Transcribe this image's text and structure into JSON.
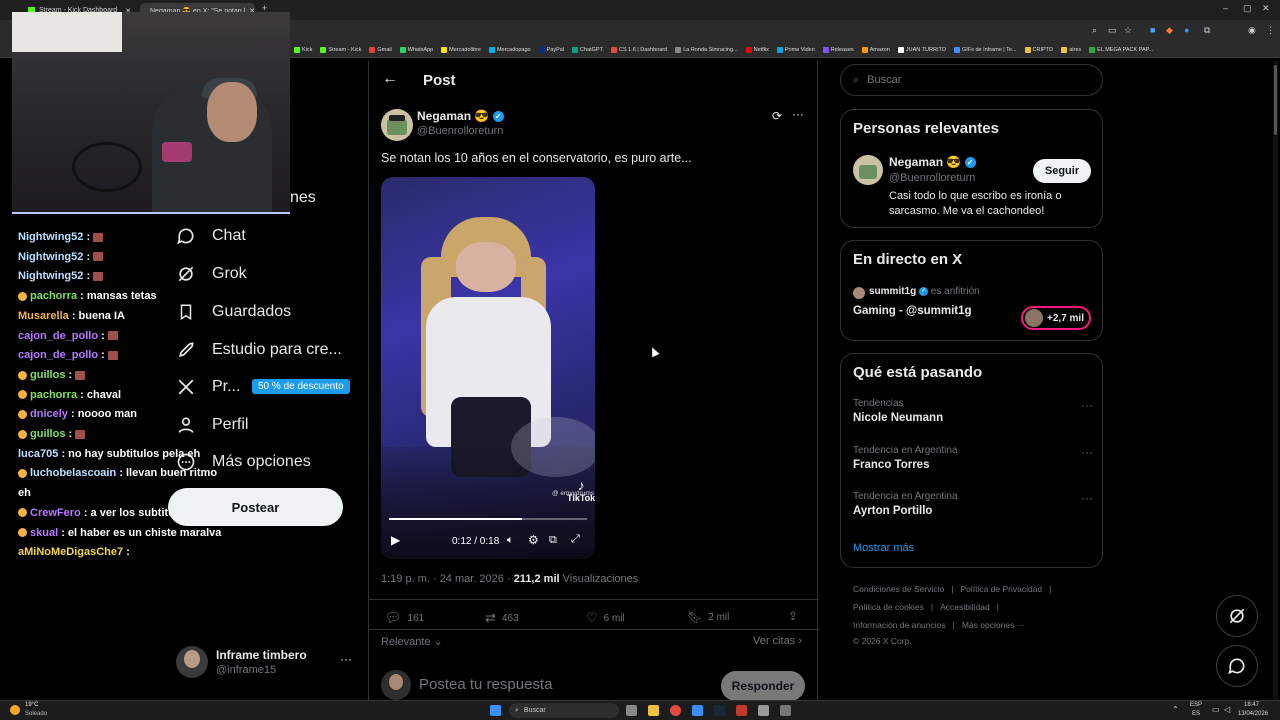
{
  "browser": {
    "tabs": [
      {
        "label": "Stream - Kick Dashboard"
      },
      {
        "label": "Negaman 😎 en X: \"Se notan l"
      }
    ],
    "new_tab": "+",
    "bookmarks": [
      "Kick",
      "Stream - Kick",
      "Gmail",
      "WhatsApp",
      "Mercadolibre",
      "Mercadopago",
      "PayPal",
      "ChatGPT",
      "CS 1.6 | Dashboard",
      "La Ronda Simracing...",
      "Netflix",
      "Prime Video",
      "Releases",
      "Amazon",
      "JUAN TURRITO",
      "GIFs de Inframe | Te...",
      "CRIPTO",
      "aires",
      "EL MEGA PACK PAP..."
    ]
  },
  "chat": {
    "messages": [
      {
        "user": "Nightwing52",
        "color": "#b9e0ff",
        "text": ":",
        "emote": true
      },
      {
        "user": "Nightwing52",
        "color": "#b9e0ff",
        "text": ":",
        "emote": true
      },
      {
        "user": "Nightwing52",
        "color": "#b9e0ff",
        "text": ":",
        "emote": true
      },
      {
        "user": "pachorra",
        "color": "#7ee15a",
        "text": ": mansas tetas",
        "emote": false,
        "badge": true
      },
      {
        "user": "Musarella",
        "color": "#f5b342",
        "text": ": buena IA",
        "emote": false
      },
      {
        "user": "cajon_de_pollo",
        "color": "#b678ff",
        "text": ":",
        "emote": true
      },
      {
        "user": "cajon_de_pollo",
        "color": "#b678ff",
        "text": ":",
        "emote": true
      },
      {
        "user": "guillos",
        "color": "#7ee15a",
        "text": ":",
        "emote": true,
        "badge": true
      },
      {
        "user": "pachorra",
        "color": "#7ee15a",
        "text": ": chaval",
        "emote": false,
        "badge": true
      },
      {
        "user": "dnicely",
        "color": "#b678ff",
        "text": ": noooo man",
        "emote": false,
        "badge": true
      },
      {
        "user": "guillos",
        "color": "#7ee15a",
        "text": ":",
        "emote": true,
        "badge": true
      },
      {
        "user": "luca705",
        "color": "#b9e0ff",
        "text": ": no hay subtitulos pela eh",
        "emote": false
      },
      {
        "user": "luchobelascoain",
        "color": "#b9e0ff",
        "text": ": llevan buen ritmo",
        "emote": false,
        "badge": true
      },
      {
        "user": "",
        "color": "#fff",
        "text": "eh",
        "emote": false
      },
      {
        "user": "CrewFero",
        "color": "#b678ff",
        "text": ": a ver los subtitulos",
        "emote": false,
        "badge": true
      },
      {
        "user": "skual",
        "color": "#b678ff",
        "text": ": el haber es un chiste maralva",
        "emote": false,
        "badge": true
      },
      {
        "user": "aMiNoMeDigasChe7",
        "color": "#f5d742",
        "text": ":",
        "emote": false
      }
    ]
  },
  "nav": {
    "partial_label": "nes",
    "items": [
      {
        "label": "Chat"
      },
      {
        "label": "Grok"
      },
      {
        "label": "Guardados"
      },
      {
        "label": "Estudio para cre..."
      },
      {
        "label": "Pr..."
      },
      {
        "label": "Perfil"
      },
      {
        "label": "Más opciones"
      }
    ],
    "premium_badge": "50 % de descuento",
    "post_button": "Postear",
    "account_name": "Inframe timbero",
    "account_handle": "@inframe15",
    "account_more": "···"
  },
  "main": {
    "header": "Post",
    "author": {
      "name": "Negaman 😎",
      "handle": "@Buenrolloreturn"
    },
    "text": "Se notan los 10 años en el conservatorio, es puro arte...",
    "video": {
      "time": "0:12 / 0:18",
      "watermark": "TikTok",
      "watermark_user": "@ emyydrums",
      "progress": 0.67
    },
    "meta_time": "1:19 p. m. · 24 mar. 2026 · ",
    "meta_views": "211,2 mil",
    "meta_views_label": " Visualizaciones",
    "stats": {
      "replies": "161",
      "reposts": "463",
      "likes": "6 mil",
      "bookmarks": "2 mil"
    },
    "sort_label": "Relevante",
    "quotes_label": "Ver citas",
    "reply_placeholder": "Postea tu respuesta",
    "reply_button": "Responder"
  },
  "right": {
    "search_placeholder": "Buscar",
    "people": {
      "title": "Personas relevantes",
      "name": "Negaman 😎",
      "handle": "@Buenrolloreturn",
      "bio": "Casi todo lo que escribo es ironía o sarcasmo. Me va el cachondeo!",
      "follow": "Seguir"
    },
    "live": {
      "title": "En directo en X",
      "host": "summit1g",
      "host_role": "es anfitrión",
      "topic": "Gaming - @summit1g",
      "listeners": "+2,7 mil"
    },
    "trends": {
      "title": "Qué está pasando",
      "items": [
        {
          "category": "Tendencias",
          "name": "Nicole Neumann"
        },
        {
          "category": "Tendencia en Argentina",
          "name": "Franco Torres"
        },
        {
          "category": "Tendencia en Argentina",
          "name": "Ayrton Portillo"
        }
      ],
      "show_more": "Mostrar más"
    },
    "footer": {
      "line1": [
        "Condiciones de Servicio",
        "|",
        "Política de Privacidad",
        "|"
      ],
      "line2": [
        "Política de cookies",
        "|",
        "Accesibilidad",
        "|"
      ],
      "line3": [
        "Información de anuncios",
        "|",
        "Más opciones ···"
      ],
      "copyright": "© 2026 X Corp."
    }
  },
  "taskbar": {
    "weather_temp": "19°C",
    "weather_desc": "Soleado",
    "search": "Buscar",
    "lang": "ESP",
    "lang2": "ES",
    "time": "18:47",
    "date": "13/04/2026"
  },
  "colors": {
    "accent": "#1d9bf0",
    "background": "#000000",
    "border": "#2f3336",
    "muted": "#71767b"
  }
}
